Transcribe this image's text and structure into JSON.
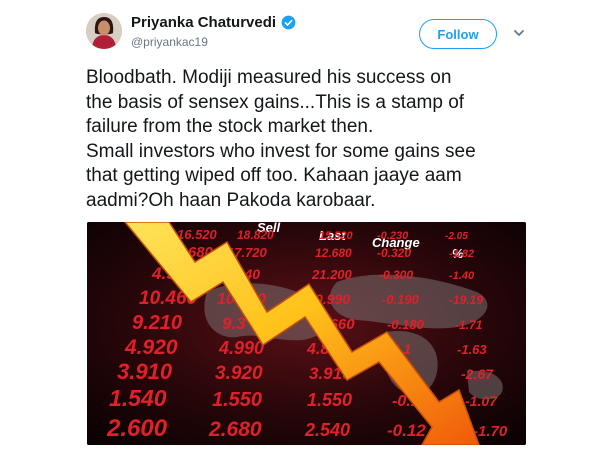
{
  "author": {
    "name": "Priyanka Chaturvedi",
    "handle": "@priyankac19",
    "verified": true,
    "avatar_icon": "profile-photo",
    "verified_icon": "verified-badge-icon"
  },
  "actions": {
    "follow_label": "Follow",
    "menu_icon": "chevron-down-icon"
  },
  "tweet": {
    "text": "Bloodbath. Modiji measured his success on\nthe basis of sensex gains...This is a stamp of\nfailure from the stock market then.\nSmall investors who invest for some gains see\nthat getting wiped off too. Kahaan jaaye aam\naadmi?Oh haan Pakoda karobaar."
  },
  "media": {
    "headers": [
      "Sell",
      "Last",
      "Change",
      "%"
    ],
    "col1": [
      "16.520",
      "13.680",
      "4.990",
      "10.460",
      "9.210",
      "4.920",
      "3.910",
      "1.540",
      "2.600"
    ],
    "col2": [
      "18.820",
      "17.720",
      "1.240",
      "10.000",
      "9.3",
      "4.990",
      "3.920",
      "1.550",
      "2.680"
    ],
    "col3": [
      "15.520",
      "12.680",
      "21.200",
      "0.990",
      "6.660",
      "4.8",
      "3.910",
      "1.550",
      "2.540"
    ],
    "col4": [
      "-0.230",
      "-0.320",
      "-0.300",
      "-0.190",
      "-0.180",
      "-0.1",
      "-0.1",
      "-0.12",
      "-0.12"
    ],
    "col5": [
      "-2.05",
      "-1.82",
      "-1.40",
      "-19.19",
      "-1.71",
      "-1.63",
      "-2.67",
      "-1.07",
      "-1.70"
    ],
    "colors": {
      "board_red": "#e0202a",
      "board_bg": "#1a0508",
      "arrow_yellow": "#ffd21f",
      "arrow_orange": "#f06a0e"
    }
  }
}
